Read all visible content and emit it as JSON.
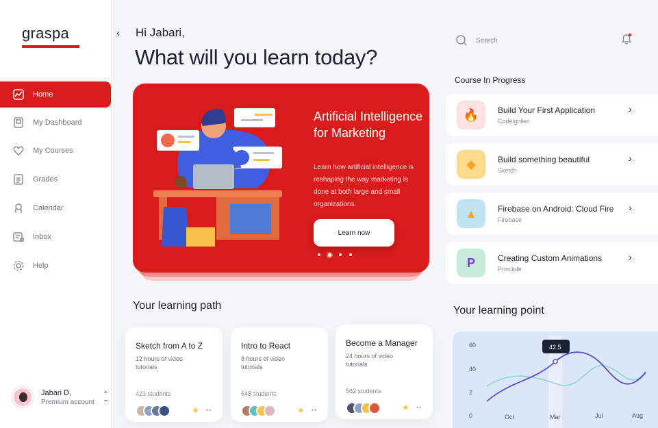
{
  "app": {
    "logo": "graspa"
  },
  "sidebar": {
    "items": [
      {
        "label": "Home",
        "icon": "chart-line-icon",
        "active": true
      },
      {
        "label": "My Dashboard",
        "icon": "dashboard-icon",
        "active": false
      },
      {
        "label": "My Courses",
        "icon": "heart-icon",
        "active": false
      },
      {
        "label": "Grades",
        "icon": "grades-icon",
        "active": false
      },
      {
        "label": "Calendar",
        "icon": "calendar-icon",
        "active": false
      },
      {
        "label": "Inbox",
        "icon": "inbox-icon",
        "active": false
      },
      {
        "label": "Help",
        "icon": "gear-icon",
        "active": false
      }
    ],
    "profile": {
      "name": "Jabari D.",
      "subtitle": "Premium account"
    }
  },
  "header": {
    "greeting": "Hi Jabari,",
    "headline": "What will you learn today?"
  },
  "hero": {
    "title": "Artificial Intelligence for Marketing",
    "description": "Learn how artificial intelligence is reshaping the way marketing is done at both large and small organizations.",
    "button": "Learn now",
    "active_slide": 2,
    "slide_count": 4
  },
  "learning_path": {
    "title": "Your learning path",
    "cards": [
      {
        "title": "Sketch from A to Z",
        "desc": "12 hours of video tutorials",
        "students": "423 students"
      },
      {
        "title": "Intro to React",
        "desc": "8 hours of video tutorials",
        "students": "648 students"
      },
      {
        "title": "Become a Manager",
        "desc": "24 hours of video tutorials",
        "students": "562 students"
      }
    ]
  },
  "search": {
    "placeholder": "Search"
  },
  "courses": {
    "title": "Course In Progress",
    "items": [
      {
        "title": "Build Your First Application",
        "sub": "Codeigniter",
        "color": "#fde1e3",
        "glyph": "🔥"
      },
      {
        "title": "Build something beautiful",
        "sub": "Sketch",
        "color": "#fdd98b",
        "glyph": "◆"
      },
      {
        "title": "Firebase on Android: Cloud Fire",
        "sub": "Firebase",
        "color": "#bfe3ef",
        "glyph": "▲"
      },
      {
        "title": "Creating Custom Animations",
        "sub": "Principle",
        "color": "#c8ecdc",
        "glyph": "P"
      }
    ]
  },
  "learning_point": {
    "title": "Your learning point"
  },
  "chart_data": {
    "type": "line",
    "x": [
      "Oct",
      "Mar",
      "Jul",
      "Aug"
    ],
    "y_ticks": [
      "60",
      "40",
      "2",
      "0"
    ],
    "tooltip": "42.5",
    "series": [
      {
        "values": [
          10,
          26,
          48,
          22,
          34
        ]
      },
      {
        "values": [
          30,
          20,
          38,
          14,
          28
        ]
      }
    ],
    "colors": {
      "primary": "#5b4bc4",
      "secondary": "#8fd3d3"
    }
  }
}
